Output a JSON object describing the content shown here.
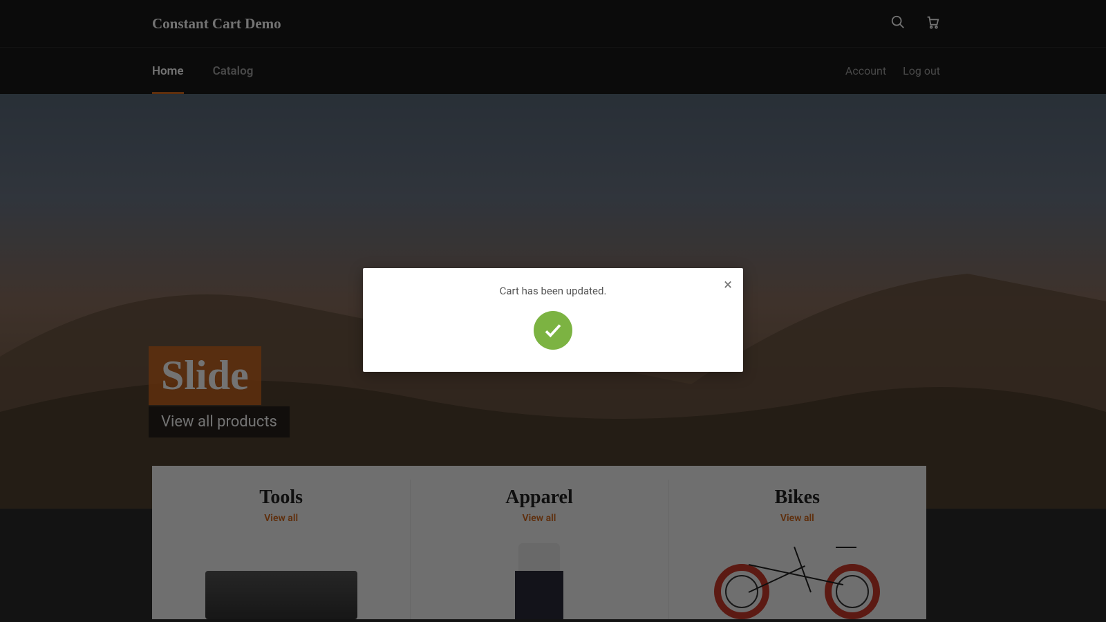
{
  "header": {
    "brand": "Constant Cart Demo"
  },
  "nav": {
    "left": [
      {
        "label": "Home",
        "active": true
      },
      {
        "label": "Catalog",
        "active": false
      }
    ],
    "right": [
      {
        "label": "Account"
      },
      {
        "label": "Log out"
      }
    ]
  },
  "hero": {
    "slide_title": "Slide",
    "slide_subtitle": "View all products"
  },
  "categories": [
    {
      "title": "Tools",
      "link": "View all"
    },
    {
      "title": "Apparel",
      "link": "View all"
    },
    {
      "title": "Bikes",
      "link": "View all"
    }
  ],
  "modal": {
    "message": "Cart has been updated.",
    "close_glyph": "×"
  },
  "icons": {
    "search": "search-icon",
    "cart": "cart-icon",
    "check": "check-icon",
    "close": "close-icon"
  },
  "colors": {
    "accent": "#d2691e",
    "success": "#7cb342",
    "header_bg": "#1a1a1a"
  }
}
